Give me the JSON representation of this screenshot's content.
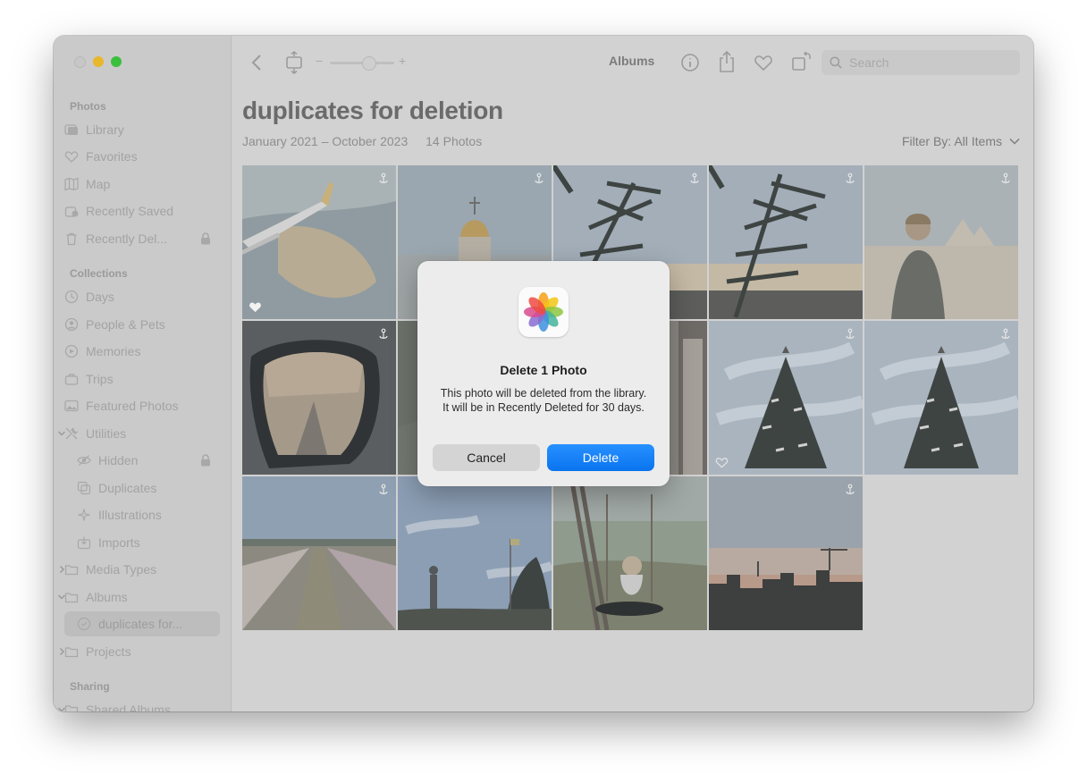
{
  "sidebar": {
    "sections": {
      "photos": "Photos",
      "collections": "Collections",
      "sharing": "Sharing"
    },
    "items": [
      {
        "label": "Library",
        "icon": "library-icon"
      },
      {
        "label": "Favorites",
        "icon": "heart-icon"
      },
      {
        "label": "Map",
        "icon": "map-icon"
      },
      {
        "label": "Recently Saved",
        "icon": "recently-saved-icon"
      },
      {
        "label": "Recently Del...",
        "icon": "trash-icon",
        "locked": true
      },
      {
        "label": "Days",
        "icon": "clock-icon"
      },
      {
        "label": "People & Pets",
        "icon": "person-icon"
      },
      {
        "label": "Memories",
        "icon": "memories-icon"
      },
      {
        "label": "Trips",
        "icon": "suitcase-icon"
      },
      {
        "label": "Featured Photos",
        "icon": "featured-photos-icon"
      },
      {
        "label": "Utilities",
        "icon": "tools-icon",
        "expanded": true
      },
      {
        "label": "Hidden",
        "icon": "eye-slash-icon",
        "locked": true
      },
      {
        "label": "Duplicates",
        "icon": "duplicates-icon"
      },
      {
        "label": "Illustrations",
        "icon": "sparkle-icon"
      },
      {
        "label": "Imports",
        "icon": "import-icon"
      },
      {
        "label": "Media Types",
        "icon": "folder-icon",
        "expanded": false
      },
      {
        "label": "Albums",
        "icon": "folder-icon",
        "expanded": true
      },
      {
        "label": "duplicates for...",
        "icon": "album-icon",
        "selected": true
      },
      {
        "label": "Projects",
        "icon": "folder-icon",
        "expanded": false
      },
      {
        "label": "Shared Albums",
        "icon": "shared-album-icon"
      }
    ]
  },
  "toolbar": {
    "title": "Albums",
    "search_placeholder": "Search",
    "zoom_minus": "−",
    "zoom_plus": "+"
  },
  "album": {
    "title": "duplicates for deletion",
    "date_range": "January 2021 – October 2023",
    "count": "14 Photos",
    "filter_label": "Filter By: All Items"
  },
  "dialog": {
    "title": "Delete 1 Photo",
    "body": "This photo will be deleted from the library. It will be in Recently Deleted for 30 days.",
    "cancel_label": "Cancel",
    "delete_label": "Delete"
  },
  "colors": {
    "accent": "#0a74f0",
    "overlay_gray": "#d2d2d2"
  }
}
